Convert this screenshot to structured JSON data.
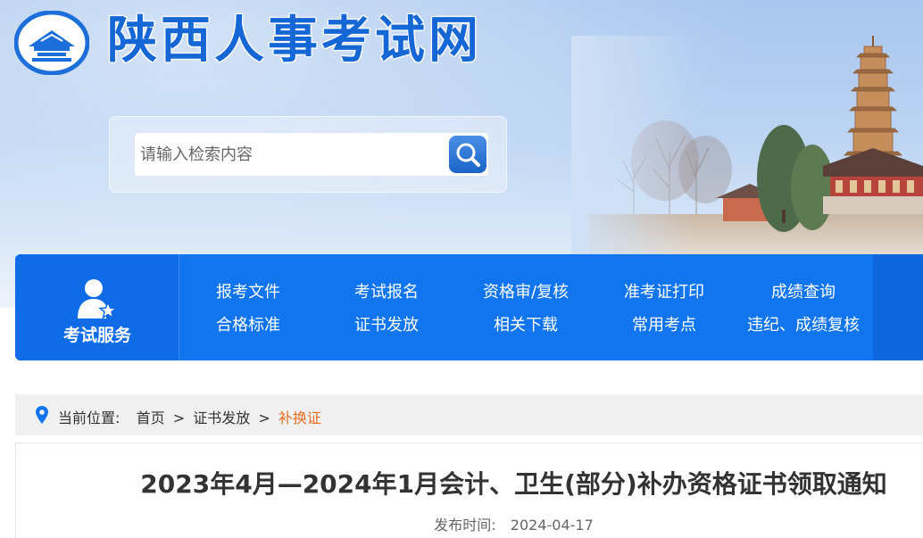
{
  "site": {
    "title": "陕西人事考试网"
  },
  "search": {
    "placeholder": "请输入检索内容"
  },
  "nav": {
    "service_label": "考试服务",
    "items_row1": [
      "报考文件",
      "考试报名",
      "资格审/复核",
      "准考证打印",
      "成绩查询"
    ],
    "items_row2": [
      "合格标准",
      "证书发放",
      "相关下载",
      "常用考点",
      "违纪、成绩复核"
    ]
  },
  "breadcrumb": {
    "prefix": "当前位置:",
    "items": [
      "首页",
      "证书发放",
      "补换证"
    ],
    "separator": ">"
  },
  "article": {
    "title": "2023年4月—2024年1月会计、卫生(部分)补办资格证书领取通知",
    "meta_label": "发布时间:",
    "date": "2024-04-17"
  },
  "colors": {
    "brand_blue": "#1275f0",
    "title_blue": "#1667d6",
    "breadcrumb_current": "#e86d1f"
  },
  "icons": [
    "logo-emblem",
    "search-icon",
    "user-star-icon",
    "location-pin-icon"
  ]
}
